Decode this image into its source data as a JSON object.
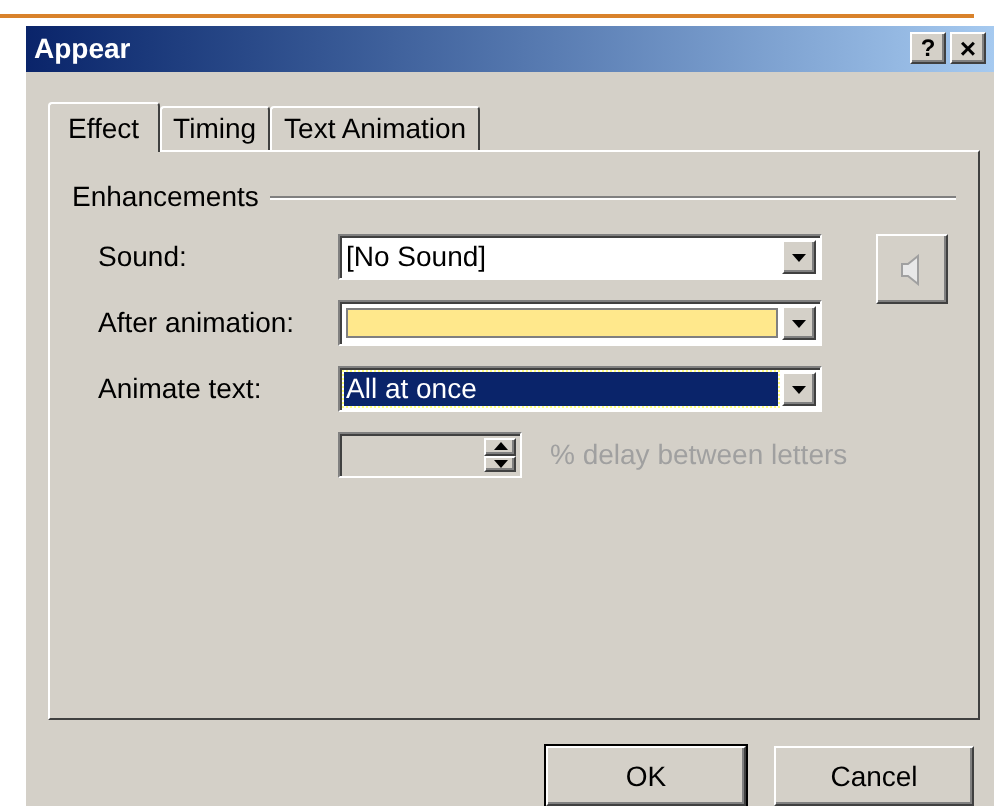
{
  "window": {
    "title": "Appear",
    "help_button": "?",
    "close_button": "×"
  },
  "tabs": [
    {
      "label": "Effect",
      "selected": true
    },
    {
      "label": "Timing",
      "selected": false
    },
    {
      "label": "Text Animation",
      "selected": false
    }
  ],
  "group": {
    "title": "Enhancements"
  },
  "fields": [
    {
      "kind": "text",
      "label": "Sound:",
      "value": "[No Sound]",
      "focused": false
    },
    {
      "kind": "swatch",
      "label": "After animation:",
      "color": "#ffe88c",
      "focused": false
    },
    {
      "kind": "text",
      "label": "Animate text:",
      "value": "All at once",
      "focused": true
    }
  ],
  "delay": {
    "disabled": true,
    "label": "% delay between letters"
  },
  "buttons": [
    {
      "label": "OK",
      "default": true
    },
    {
      "label": "Cancel",
      "default": false
    }
  ]
}
